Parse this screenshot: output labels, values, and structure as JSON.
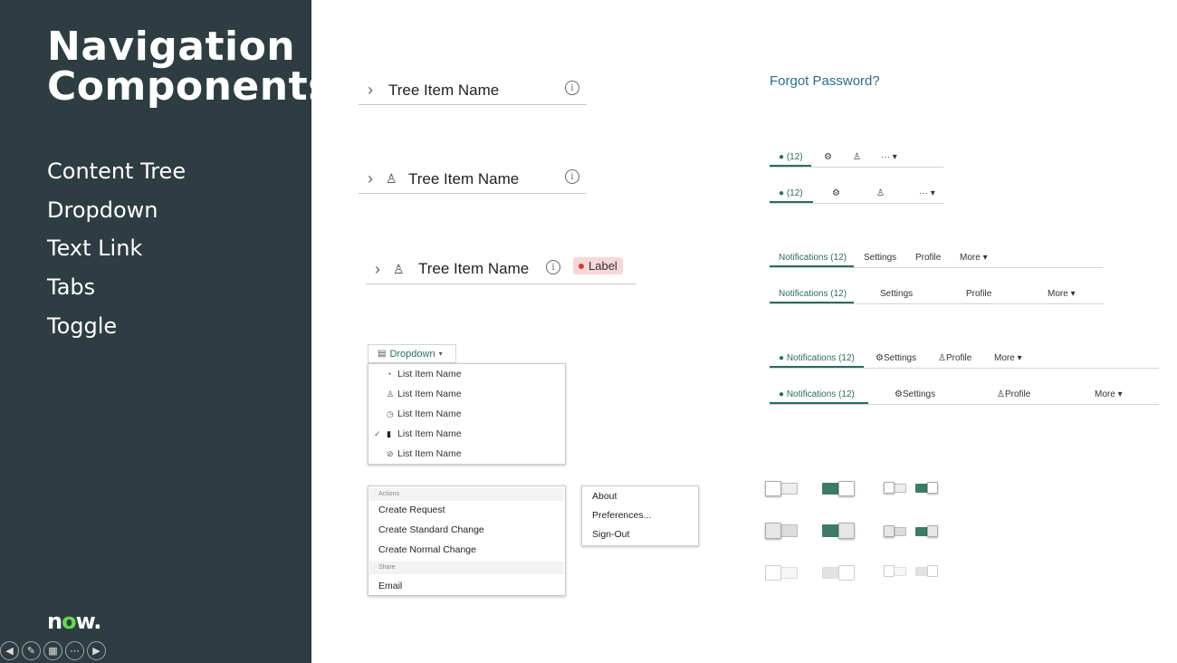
{
  "slide": {
    "title_line1": "Navigation",
    "title_line2": "Components",
    "topics": [
      "Content Tree",
      "Dropdown",
      "Text Link",
      "Tabs",
      "Toggle"
    ],
    "logo": {
      "before": "n",
      "o": "o",
      "after": "w",
      "suffix": "."
    }
  },
  "tree": {
    "items": [
      {
        "name": "Tree Item Name"
      },
      {
        "name": "Tree Item Name"
      },
      {
        "name": "Tree Item Name",
        "label": "Label"
      }
    ]
  },
  "dropdown": {
    "button_label": "Dropdown",
    "items": [
      "List Item Name",
      "List Item Name",
      "List Item Name",
      "List Item Name",
      "List Item Name"
    ],
    "selected_index": 3
  },
  "actions_menu": {
    "header_actions": "Actions",
    "items": [
      "Create Request",
      "Create Standard Change",
      "Create Normal Change"
    ],
    "header_share": "Share",
    "share_item": "Email"
  },
  "user_menu": {
    "items": [
      "About",
      "Preferences...",
      "Sign-Out"
    ]
  },
  "text_link": "Forgot Password?",
  "tabs": {
    "count_tab": "(12)",
    "notifications": "Notifications (12)",
    "settings": "Settings",
    "profile": "Profile",
    "more": "More"
  },
  "colors": {
    "accent": "#2c6b60",
    "sidebar": "#2e3d42",
    "link": "#2d6d8f",
    "label_bg": "#f7d7d7"
  }
}
